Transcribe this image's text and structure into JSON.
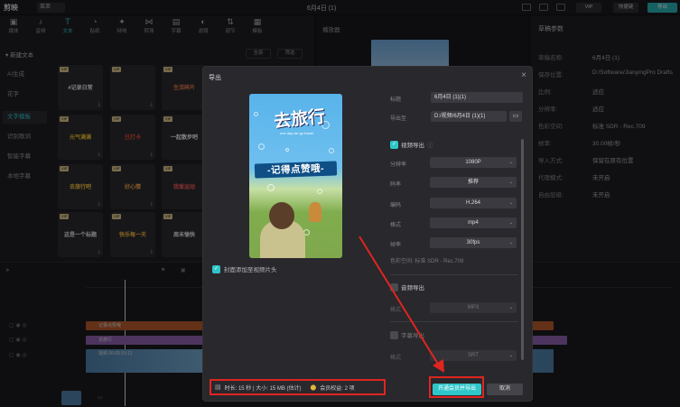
{
  "app": {
    "name": "剪映",
    "menu_label": "菜单",
    "window_title": "6月4日 (1)",
    "vip_label": "VIP",
    "shortcut_label": "快捷键",
    "export_label": "导出"
  },
  "toolbar": {
    "items": [
      {
        "label": "媒体",
        "icon": "media-icon"
      },
      {
        "label": "音频",
        "icon": "audio-icon"
      },
      {
        "label": "文本",
        "icon": "text-icon"
      },
      {
        "label": "贴纸",
        "icon": "sticker-icon"
      },
      {
        "label": "特效",
        "icon": "effects-icon"
      },
      {
        "label": "转场",
        "icon": "transition-icon"
      },
      {
        "label": "字幕",
        "icon": "subtitle-icon"
      },
      {
        "label": "滤镜",
        "icon": "filter-icon"
      },
      {
        "label": "调节",
        "icon": "adjust-icon"
      },
      {
        "label": "模板",
        "icon": "template-icon"
      }
    ]
  },
  "sidebar": {
    "section": "新建文本",
    "items": [
      "AI生成",
      "花字",
      "文字模板",
      "识别歌词",
      "智能字幕",
      "本地字幕"
    ],
    "active_index": 2,
    "filter_all": "全部",
    "filter_other": "筛选"
  },
  "templates": [
    {
      "text": "#记录日常",
      "color": "#e9e9e9"
    },
    {
      "text": "",
      "color": "#ffffff"
    },
    {
      "text": "生活碎片",
      "color": "#e77b4c"
    },
    {
      "text": "元气满满",
      "color": "#f1c232"
    },
    {
      "text": "已打卡",
      "color": "#e84b3c"
    },
    {
      "text": "一起散步吧",
      "color": "#f5f5f5"
    },
    {
      "text": "去旅行吧",
      "color": "#f6c244"
    },
    {
      "text": "好心情",
      "color": "#f0a14a"
    },
    {
      "text": "我爱运动",
      "color": "#f05a5a"
    },
    {
      "text": "这是一个标题",
      "color": "#e5e5e5"
    },
    {
      "text": "快乐每一天",
      "color": "#f5b843"
    },
    {
      "text": "周末愉快",
      "color": "#e8e8e8"
    }
  ],
  "player": {
    "title": "播放器"
  },
  "draft": {
    "title": "草稿参数",
    "rows": [
      {
        "k": "草稿名称:",
        "v": "6月4日 (1)"
      },
      {
        "k": "保存位置:",
        "v": "D:/Software/JianyingPro Drafts"
      },
      {
        "k": "比例:",
        "v": "适应"
      },
      {
        "k": "分辨率:",
        "v": "适应"
      },
      {
        "k": "色彩空间:",
        "v": "标准 SDR - Rec.709"
      },
      {
        "k": "帧率:",
        "v": "30.00帧/秒"
      },
      {
        "k": "导入方式:",
        "v": "保留在原有位置"
      },
      {
        "k": "代理模式:",
        "v": "未开启"
      },
      {
        "k": "自由层级:",
        "v": "未开启"
      }
    ]
  },
  "timeline": {
    "tracks": [
      "记录点赞哦",
      "去旅行",
      "视频  00:00:15:11"
    ]
  },
  "dialog": {
    "title": "导出",
    "title_label": "标题",
    "title_value": "6月4日 (1)(1)",
    "path_label": "导出至",
    "path_value": "D:/视频/6月4日 (1)(1)",
    "cover_title": "去旅行",
    "cover_subtitle": "one day we go travel",
    "cover_banner": "-记得点赞哦-",
    "cover_checkbox": "封面添加至视频片头",
    "video_section": "视频导出",
    "video_fields": [
      {
        "label": "分辨率",
        "value": "1080P"
      },
      {
        "label": "码率",
        "value": "推荐"
      },
      {
        "label": "编码",
        "value": "H.264"
      },
      {
        "label": "格式",
        "value": "mp4"
      },
      {
        "label": "帧率",
        "value": "30fps"
      }
    ],
    "color_space": "色彩空间: 标准 SDR - Rec.709",
    "audio_section": "音频导出",
    "audio_format_label": "格式",
    "audio_format": "MP3",
    "subtitle_section": "字幕导出",
    "subtitle_format_label": "格式",
    "subtitle_format": "SRT",
    "info_duration": "时长: 15 秒 | 大小: 15 MB (估计)",
    "info_member": "会员权益: 2 项",
    "primary_button": "开通会员并导出",
    "cancel_button": "取消"
  },
  "colors": {
    "accent": "#2fc6c9",
    "highlight": "#e0251f"
  }
}
